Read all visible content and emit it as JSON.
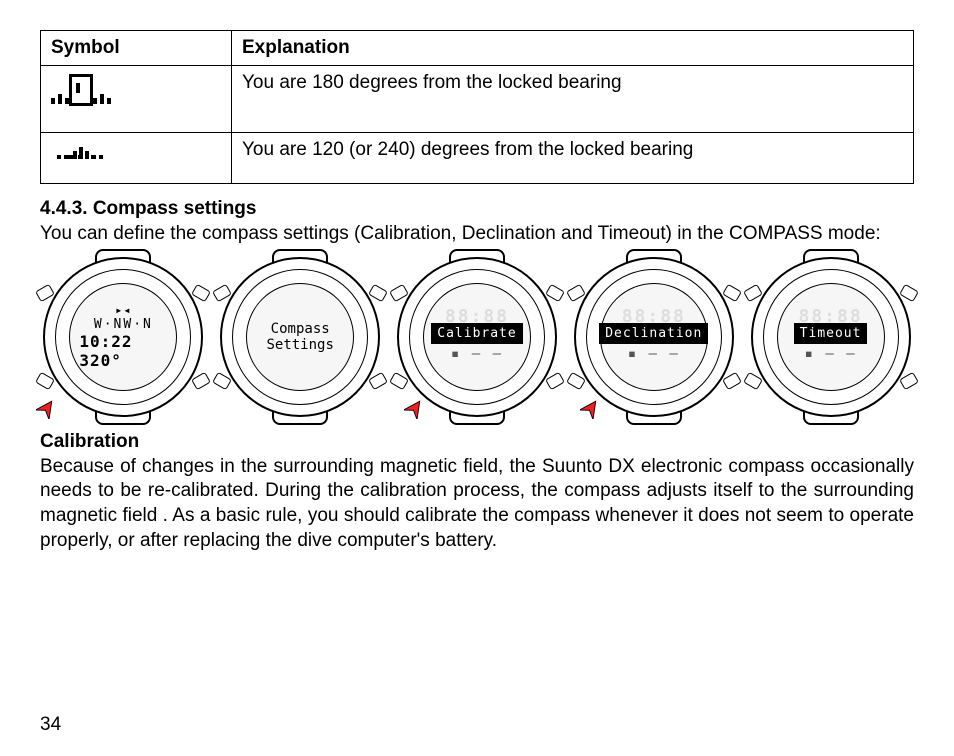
{
  "table": {
    "headers": {
      "symbol": "Symbol",
      "explanation": "Explanation"
    },
    "rows": [
      {
        "explanation": "You are 180 degrees from the locked bearing"
      },
      {
        "explanation": "You are 120 (or 240) degrees from the locked bearing"
      }
    ]
  },
  "section": {
    "heading": "4.4.3. Compass settings",
    "intro": "You can define the compass settings (Calibration, Declination and Timeout) in the COMPASS mode:"
  },
  "watches": [
    {
      "upper": "▸◂",
      "mid": "W·NW·N",
      "lower": "10:22 320°"
    },
    {
      "line1": "Compass",
      "line2": "Settings"
    },
    {
      "label": "Calibrate"
    },
    {
      "label": "Declination"
    },
    {
      "label": "Timeout"
    }
  ],
  "calibration": {
    "heading": "Calibration",
    "body": "Because of changes in the surrounding magnetic field, the Suunto DX electronic compass occasionally needs to be re-calibrated. During the calibration process, the compass adjusts itself to the surrounding magnetic field . As a basic rule, you should calibrate the compass whenever it does not seem to operate properly, or after replacing the dive computer's battery."
  },
  "page_number": "34"
}
